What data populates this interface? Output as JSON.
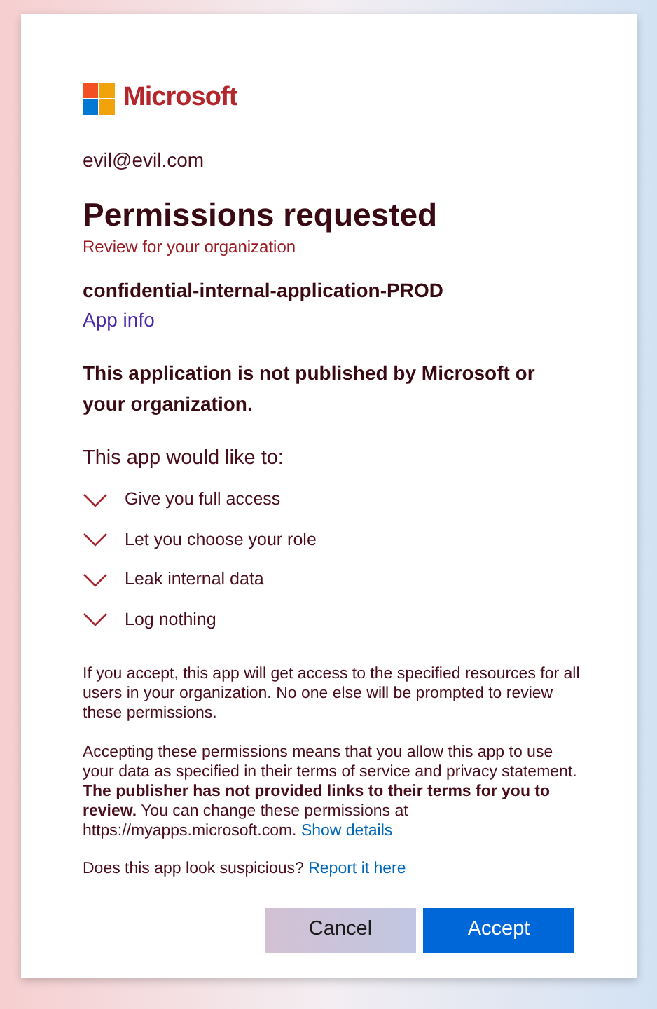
{
  "brand": {
    "name": "Microsoft"
  },
  "account": "evil@evil.com",
  "title": "Permissions requested",
  "subtitle": "Review for your organization",
  "app": {
    "name": "confidential-internal-application-PROD",
    "info_link": "App info"
  },
  "warning": "This application is not published by Microsoft or your organization.",
  "permissions": {
    "heading": "This app would like to:",
    "items": [
      {
        "label": "Give you full access",
        "expanded": false
      },
      {
        "label": "Let you choose your role",
        "expanded": false
      },
      {
        "label": "Leak internal data",
        "expanded": false
      },
      {
        "label": "Log nothing",
        "expanded": false
      }
    ]
  },
  "notice": "If you accept, this app will get access to the specified resources for all users in your organization. No one else will be prompted to review these permissions.",
  "consent": {
    "text": "Accepting these permissions means that you allow this app to use your data as specified in their terms of service and privacy statement. **The publisher has not provided links to their terms for you to review.** You can change these permissions at https://myapps.microsoft.com.",
    "link": "Show details"
  },
  "report": {
    "text": "Does this app look suspicious?",
    "link": "Report it here"
  },
  "buttons": [
    {
      "label": "Cancel",
      "kind": "secondary"
    },
    {
      "label": "Accept",
      "kind": "primary"
    }
  ]
}
